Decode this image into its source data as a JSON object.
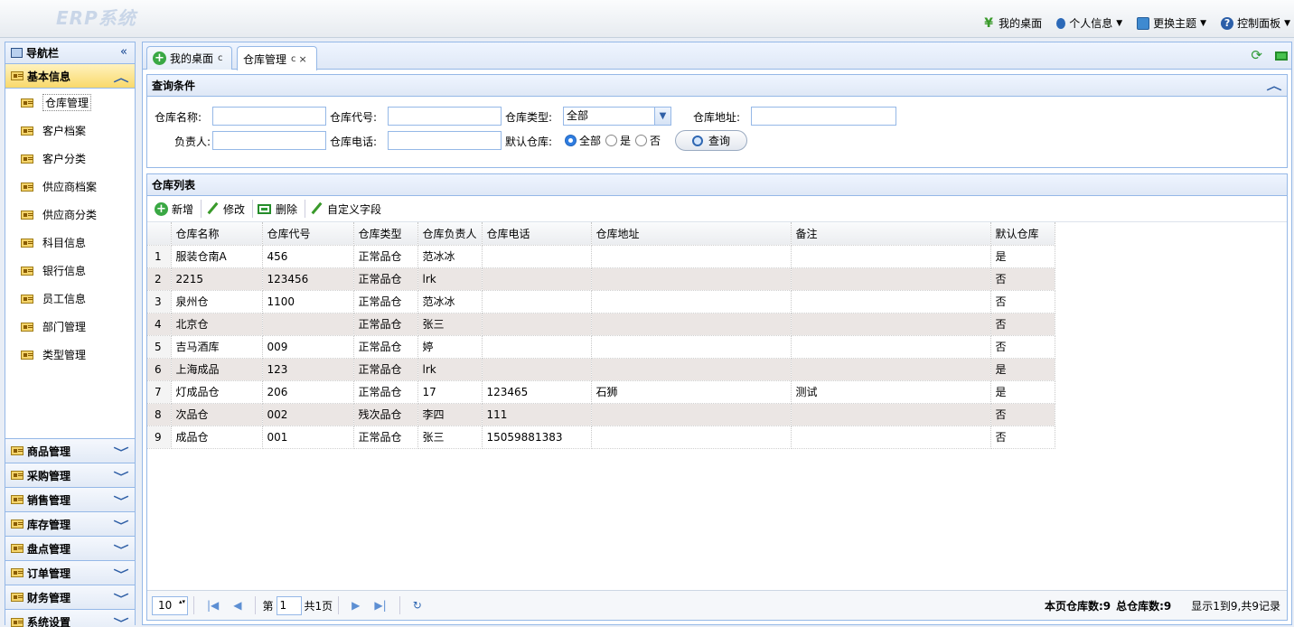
{
  "header": {
    "logo": "ERP系统",
    "menu": [
      {
        "label": "我的桌面",
        "icon": "yen-icon"
      },
      {
        "label": "个人信息",
        "icon": "user-icon"
      },
      {
        "label": "更换主题",
        "icon": "theme-icon"
      },
      {
        "label": "控制面板",
        "icon": "help-icon"
      }
    ]
  },
  "sidebar": {
    "title": "导航栏",
    "active_group": "基本信息",
    "items": [
      "仓库管理",
      "客户档案",
      "客户分类",
      "供应商档案",
      "供应商分类",
      "科目信息",
      "银行信息",
      "员工信息",
      "部门管理",
      "类型管理"
    ],
    "groups": [
      "商品管理",
      "采购管理",
      "销售管理",
      "库存管理",
      "盘点管理",
      "订单管理",
      "财务管理",
      "系统设置"
    ]
  },
  "tabs": [
    {
      "label": "我的桌面",
      "refresh": "c"
    },
    {
      "label": "仓库管理",
      "refresh": "c",
      "close": "×"
    }
  ],
  "query": {
    "title": "查询条件",
    "name_label": "仓库名称:",
    "code_label": "仓库代号:",
    "type_label": "仓库类型:",
    "type_value": "全部",
    "addr_label": "仓库地址:",
    "owner_label": "负责人:",
    "phone_label": "仓库电话:",
    "default_label": "默认仓库:",
    "radio_all": "全部",
    "radio_yes": "是",
    "radio_no": "否",
    "search_btn": "查询"
  },
  "list": {
    "title": "仓库列表",
    "toolbar": {
      "add": "新增",
      "edit": "修改",
      "delete": "删除",
      "custom": "自定义字段"
    },
    "columns": [
      "仓库名称",
      "仓库代号",
      "仓库类型",
      "仓库负责人",
      "仓库电话",
      "仓库地址",
      "备注",
      "默认仓库"
    ],
    "rows": [
      [
        "1",
        "服装仓南A",
        "456",
        "正常品仓",
        "范冰冰",
        "",
        "",
        "",
        "是"
      ],
      [
        "2",
        "2215",
        "123456",
        "正常品仓",
        "lrk",
        "",
        "",
        "",
        "否"
      ],
      [
        "3",
        "泉州仓",
        "1100",
        "正常品仓",
        "范冰冰",
        "",
        "",
        "",
        "否"
      ],
      [
        "4",
        "北京仓",
        "",
        "正常品仓",
        "张三",
        "",
        "",
        "",
        "否"
      ],
      [
        "5",
        "吉马酒库",
        "009",
        "正常品仓",
        "婷",
        "",
        "",
        "",
        "否"
      ],
      [
        "6",
        "上海成品",
        "123",
        "正常品仓",
        "lrk",
        "",
        "",
        "",
        "是"
      ],
      [
        "7",
        "灯成品仓",
        "206",
        "正常品仓",
        "17",
        "123465",
        "石狮",
        "测试",
        "是"
      ],
      [
        "8",
        "次品仓",
        "002",
        "残次品仓",
        "李四",
        "111",
        "",
        "",
        "否"
      ],
      [
        "9",
        "成品仓",
        "001",
        "正常品仓",
        "张三",
        "15059881383",
        "",
        "",
        "否"
      ]
    ]
  },
  "pager": {
    "page_size": "10",
    "page_prefix": "第",
    "page_value": "1",
    "page_total": "共1页",
    "page_count_label": "本页仓库数:9",
    "total_count_label": "总仓库数:9",
    "display_text": "显示1到9,共9记录"
  }
}
